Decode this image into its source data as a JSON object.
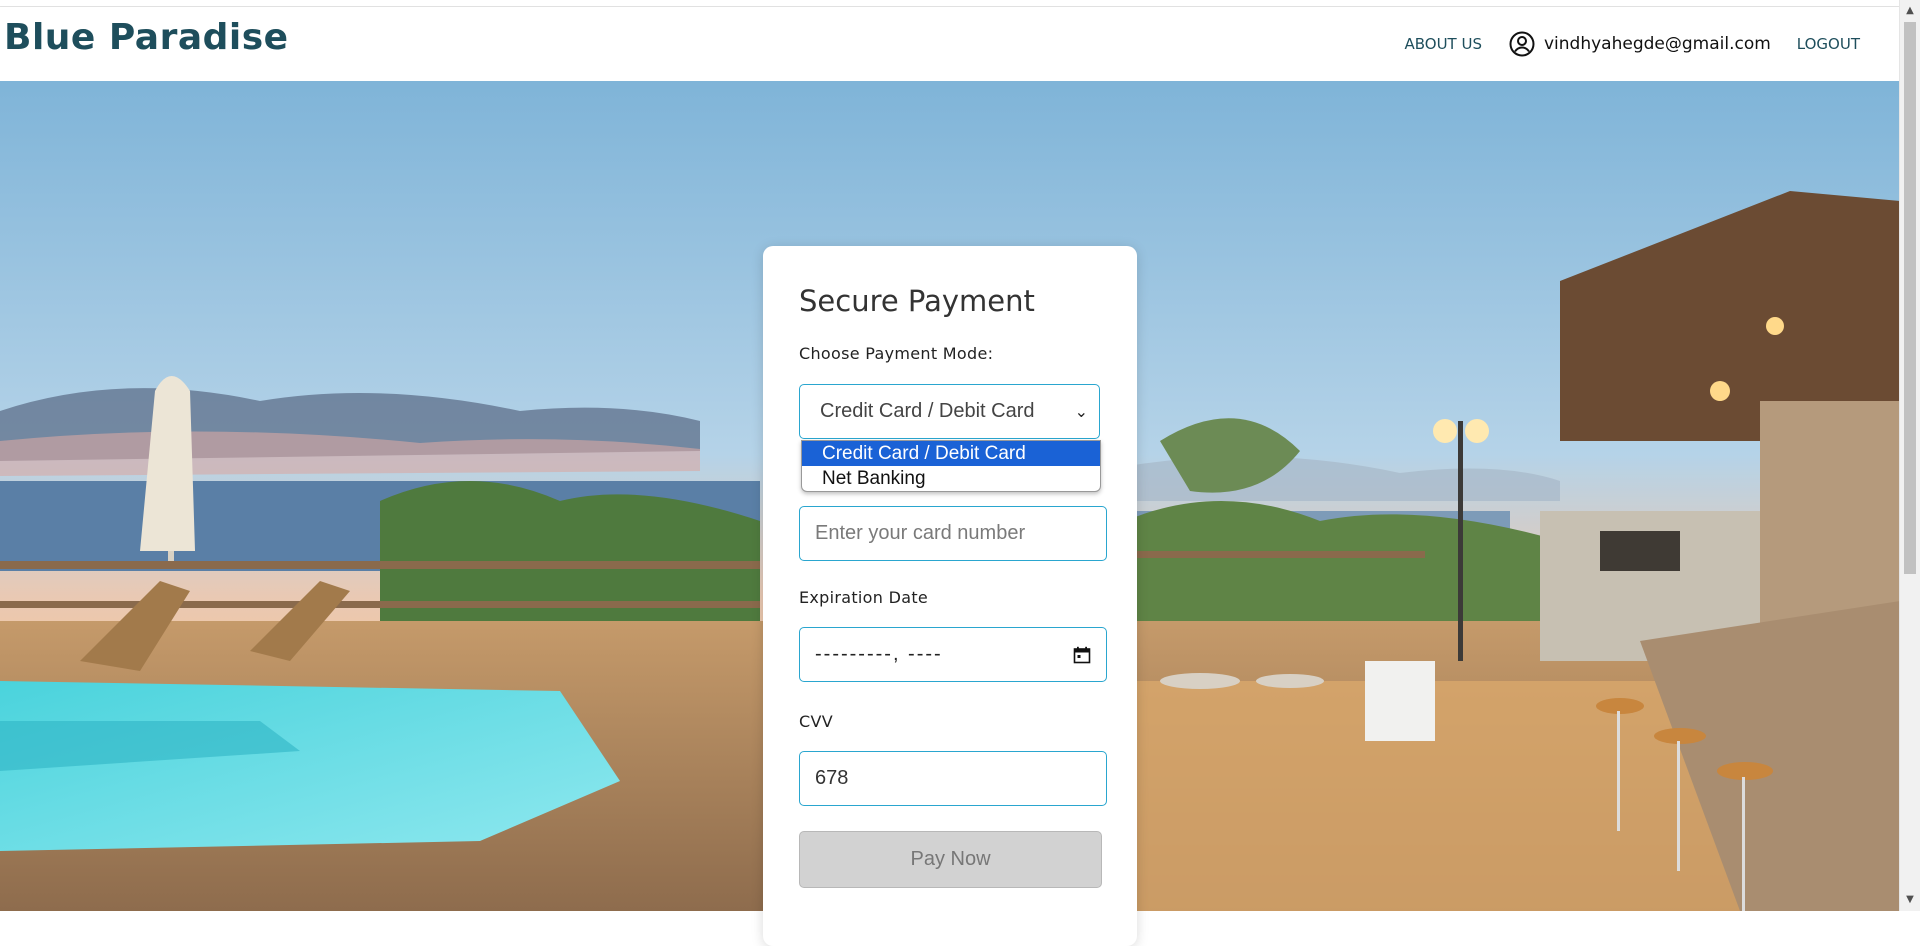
{
  "header": {
    "brand": "Blue Paradise",
    "about_label": "ABOUT US",
    "user_email": "vindhyahegde@gmail.com",
    "logout_label": "LOGOUT",
    "user_icon": "user-circle-icon"
  },
  "payment": {
    "title": "Secure Payment",
    "mode_label": "Choose Payment Mode:",
    "selected_mode": "Credit Card / Debit Card",
    "options": [
      "Credit Card / Debit Card",
      "Net Banking"
    ],
    "card_placeholder": "Enter your card number",
    "expiration_label": "Expiration Date",
    "expiration_value": "---------, ----",
    "cvv_label": "CVV",
    "cvv_value": "678",
    "pay_label": "Pay Now"
  },
  "colors": {
    "brand": "#1e4e5c",
    "input_border": "#2aa6cf",
    "option_highlight": "#1a62d6",
    "button_disabled": "#d2d2d2"
  }
}
